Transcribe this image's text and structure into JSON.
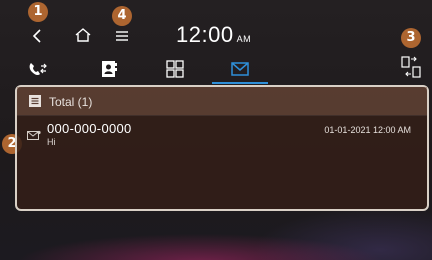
{
  "status_bar": {
    "time": "12:00",
    "ampm": "AM"
  },
  "callouts": [
    "1",
    "2",
    "3",
    "4"
  ],
  "tabs": [
    {
      "name": "call-log",
      "icon": "phone-arrows-icon",
      "selected": false
    },
    {
      "name": "contacts",
      "icon": "contacts-book-icon",
      "selected": false
    },
    {
      "name": "dial-pad",
      "icon": "keypad-icon",
      "selected": false
    },
    {
      "name": "messages",
      "icon": "envelope-icon",
      "selected": true
    }
  ],
  "message_list": {
    "header": "Total (1)",
    "items": [
      {
        "sender": "000-000-0000",
        "preview": "Hi",
        "timestamp": "01-01-2021 12:00 AM"
      }
    ]
  },
  "colors": {
    "accent": "#2f8fd8",
    "marker": "#ad6530",
    "panel_border": "#d9d0c6"
  }
}
